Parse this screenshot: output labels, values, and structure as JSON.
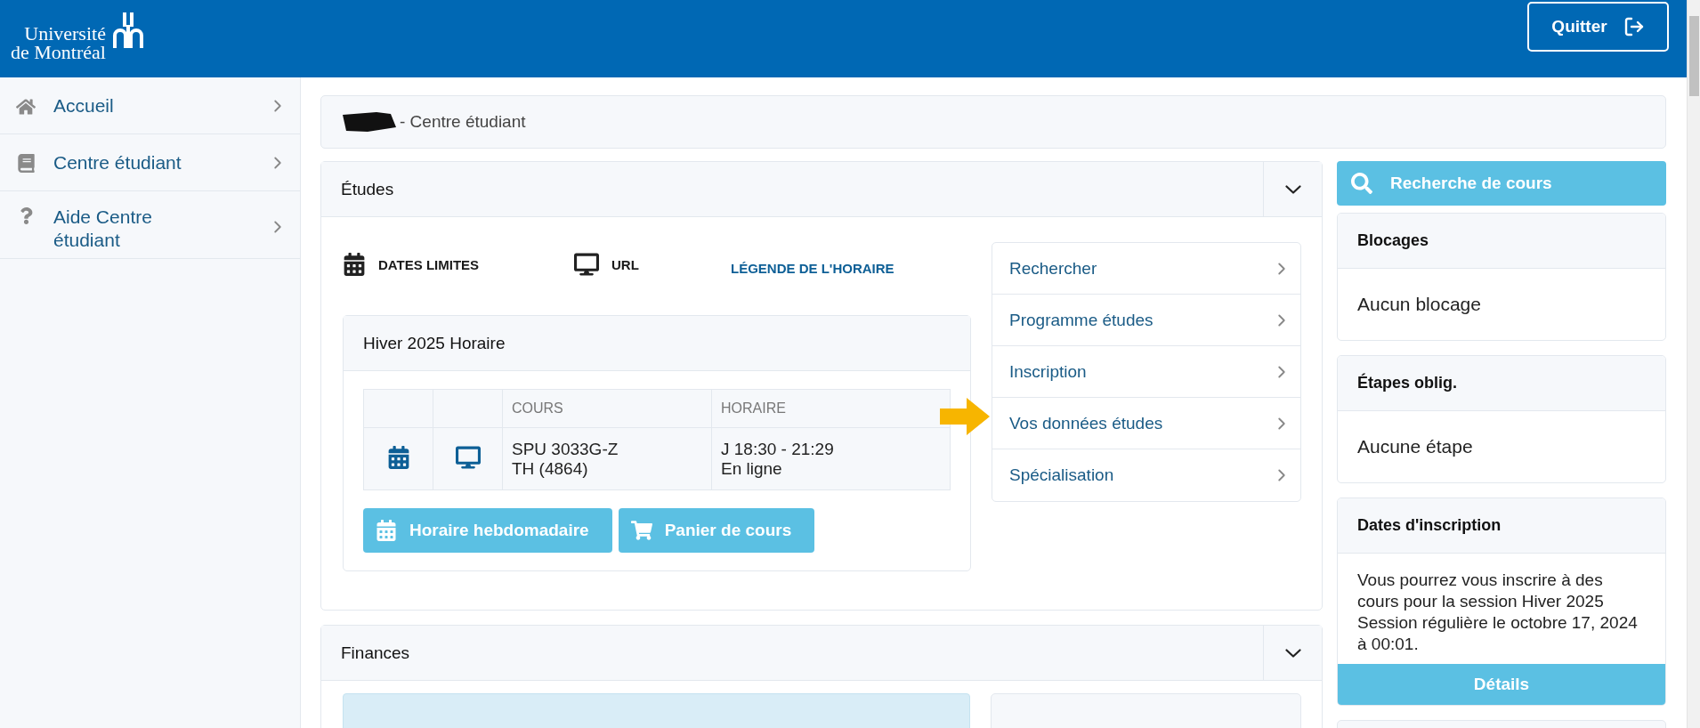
{
  "header": {
    "logo_lines": [
      "Université",
      "de Montréal"
    ],
    "quit_button": "Quitter"
  },
  "sidebar": {
    "items": [
      {
        "kind": "home",
        "label": "Accueil"
      },
      {
        "kind": "book",
        "label": "Centre étudiant"
      },
      {
        "kind": "help",
        "label": "Aide Centre étudiant"
      }
    ]
  },
  "breadcrumb": {
    "text": "- Centre étudiant"
  },
  "etudes": {
    "title": "Études",
    "quick_links": [
      {
        "kind": "calendar",
        "label": "DATES LIMITES"
      },
      {
        "kind": "monitor",
        "label": "URL"
      },
      {
        "kind": "link",
        "label": "LÉGENDE DE L'HORAIRE"
      }
    ],
    "schedule": {
      "title": "Hiver 2025 Horaire",
      "columns": [
        "COURS",
        "HORAIRE"
      ],
      "rows": [
        {
          "course": [
            "SPU 3033G-Z",
            "TH (4864)"
          ],
          "time": [
            "J 18:30 - 21:29",
            "En ligne"
          ]
        }
      ],
      "buttons": [
        {
          "kind": "calendar",
          "label": "Horaire hebdomadaire"
        },
        {
          "kind": "cart",
          "label": "Panier de cours"
        }
      ]
    },
    "menu": [
      "Rechercher",
      "Programme études",
      "Inscription",
      "Vos données études",
      "Spécialisation"
    ]
  },
  "right_column": {
    "search_button": "Recherche de cours",
    "cards": [
      {
        "title": "Blocages",
        "body": "Aucun blocage"
      },
      {
        "title": "Étapes oblig.",
        "body": "Aucune étape"
      }
    ],
    "dates": {
      "title": "Dates d'inscription",
      "body": "Vous pourrez vous inscrire à des cours pour la session Hiver 2025 Session régulière le octobre 17, 2024 à 00:01.",
      "button": "Détails"
    }
  },
  "finances": {
    "title": "Finances"
  }
}
